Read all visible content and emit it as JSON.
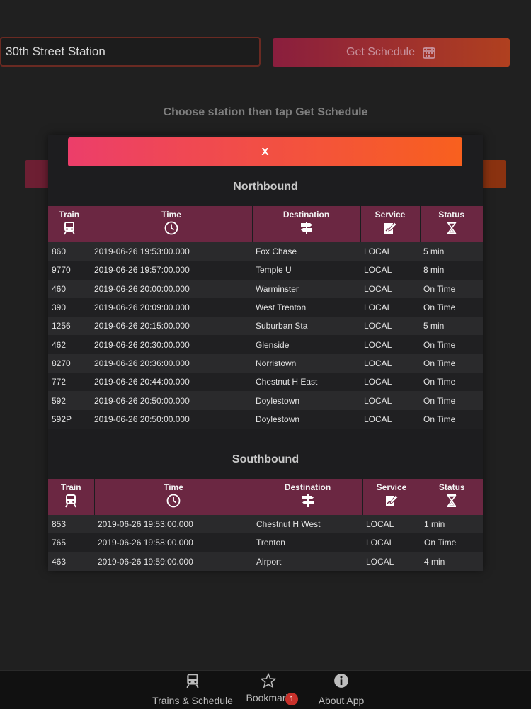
{
  "search": {
    "station_value": "30th Street Station",
    "button_label": "Get Schedule"
  },
  "hint": "Choose station then tap Get Schedule",
  "modal": {
    "close_label": "X",
    "headers": {
      "train": "Train",
      "time": "Time",
      "destination": "Destination",
      "service": "Service",
      "status": "Status"
    },
    "northbound": {
      "title": "Northbound",
      "rows": [
        [
          "860",
          "2019-06-26 19:53:00.000",
          "Fox Chase",
          "LOCAL",
          "5 min"
        ],
        [
          "9770",
          "2019-06-26 19:57:00.000",
          "Temple U",
          "LOCAL",
          "8 min"
        ],
        [
          "460",
          "2019-06-26 20:00:00.000",
          "Warminster",
          "LOCAL",
          "On Time"
        ],
        [
          "390",
          "2019-06-26 20:09:00.000",
          "West Trenton",
          "LOCAL",
          "On Time"
        ],
        [
          "1256",
          "2019-06-26 20:15:00.000",
          "Suburban Sta",
          "LOCAL",
          "5 min"
        ],
        [
          "462",
          "2019-06-26 20:30:00.000",
          "Glenside",
          "LOCAL",
          "On Time"
        ],
        [
          "8270",
          "2019-06-26 20:36:00.000",
          "Norristown",
          "LOCAL",
          "On Time"
        ],
        [
          "772",
          "2019-06-26 20:44:00.000",
          "Chestnut H East",
          "LOCAL",
          "On Time"
        ],
        [
          "592",
          "2019-06-26 20:50:00.000",
          "Doylestown",
          "LOCAL",
          "On Time"
        ],
        [
          "592P",
          "2019-06-26 20:50:00.000",
          "Doylestown",
          "LOCAL",
          "On Time"
        ]
      ]
    },
    "southbound": {
      "title": "Southbound",
      "rows": [
        [
          "853",
          "2019-06-26 19:53:00.000",
          "Chestnut H West",
          "LOCAL",
          "1 min"
        ],
        [
          "765",
          "2019-06-26 19:58:00.000",
          "Trenton",
          "LOCAL",
          "On Time"
        ],
        [
          "463",
          "2019-06-26 19:59:00.000",
          "Airport",
          "LOCAL",
          "4 min"
        ]
      ]
    }
  },
  "tabs": [
    {
      "label": "Trains & Schedule",
      "icon": "train-icon"
    },
    {
      "label": "Bookmark",
      "icon": "star-icon",
      "badge": "1"
    },
    {
      "label": "About App",
      "icon": "info-icon"
    }
  ],
  "colors": {
    "accent_start": "#ec3e6a",
    "accent_end": "#f8601e",
    "table_header": "#6b2742",
    "background": "#202020"
  }
}
